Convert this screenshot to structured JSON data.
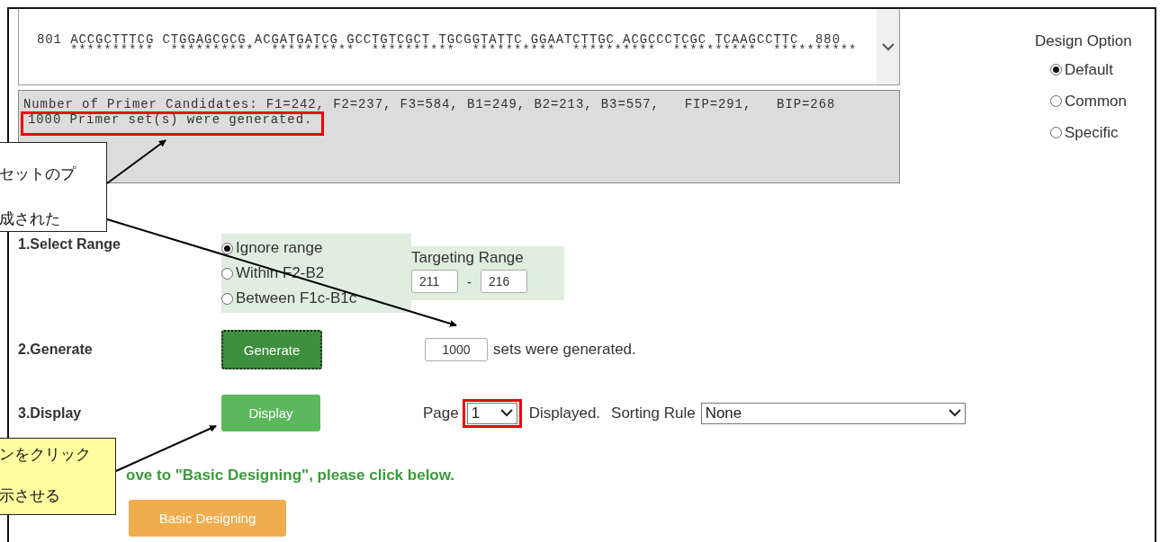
{
  "sequence_panel": {
    "line": "801 ACCGCTTTCG CTGGAGCGCG ACGATGATCG GCCTGTCGCT TGCGGTATTC GGAATCTTGC ACGCCCTCGC TCAAGCCTTC  880",
    "marks": "**********  **********  **********  **********  **********  **********  **********  **********"
  },
  "output_panel": {
    "lines": [
      "Number of Primer Candidates: F1=242, F2=237, F3=584, B1=249, B2=213, B3=557,   FIP=291,   BIP=268",
      "1000 Primer set(s) were generated."
    ]
  },
  "design_option": {
    "title": "Design Option",
    "options": [
      {
        "label": "Default",
        "selected": true
      },
      {
        "label": "Common",
        "selected": false
      },
      {
        "label": "Specific",
        "selected": false
      }
    ]
  },
  "select_range": {
    "label": "1.Select Range",
    "options": [
      {
        "label": "Ignore range",
        "selected": true
      },
      {
        "label": "Within F2-B2",
        "selected": false
      },
      {
        "label": "Between F1c-B1c",
        "selected": false
      }
    ],
    "targeting_label": "Targeting Range",
    "from": "211",
    "separator": "-",
    "to": "216"
  },
  "generate": {
    "label": "2.Generate",
    "button": "Generate",
    "count": "1000",
    "suffix": "sets were generated."
  },
  "display": {
    "label": "3.Display",
    "button": "Display",
    "page_label": "Page",
    "page": "1",
    "displayed": "Displayed.",
    "sorting_label": "Sorting Rule",
    "sorting": "None"
  },
  "basic": {
    "hint": "ove to \"Basic Designing\", please click below.",
    "button": "Basic Designing"
  },
  "annotations": [
    {
      "kind": "plain",
      "lines": [
        "セットのプ",
        "成された"
      ]
    },
    {
      "kind": "yellow",
      "lines": [
        "ンをクリック",
        "示させる"
      ]
    }
  ]
}
